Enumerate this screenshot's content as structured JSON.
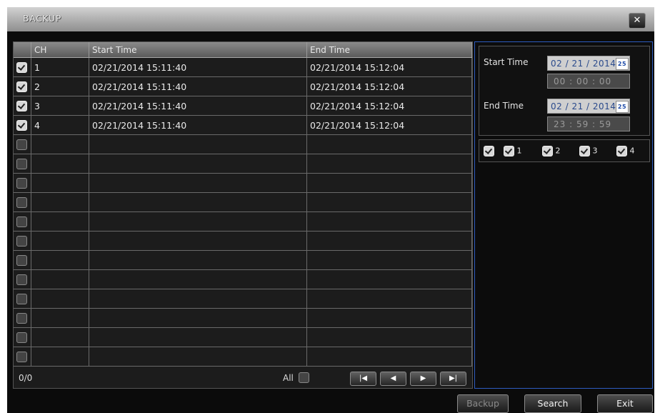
{
  "window": {
    "title": "BACKUP",
    "close_icon": "close-icon"
  },
  "table": {
    "headers": {
      "ch": "CH",
      "start": "Start Time",
      "end": "End Time"
    },
    "rows": [
      {
        "checked": true,
        "ch": "1",
        "start": "02/21/2014 15:11:40",
        "end": "02/21/2014 15:12:04"
      },
      {
        "checked": true,
        "ch": "2",
        "start": "02/21/2014 15:11:40",
        "end": "02/21/2014 15:12:04"
      },
      {
        "checked": true,
        "ch": "3",
        "start": "02/21/2014 15:11:40",
        "end": "02/21/2014 15:12:04"
      },
      {
        "checked": true,
        "ch": "4",
        "start": "02/21/2014 15:11:40",
        "end": "02/21/2014 15:12:04"
      },
      {
        "checked": false,
        "ch": "",
        "start": "",
        "end": ""
      },
      {
        "checked": false,
        "ch": "",
        "start": "",
        "end": ""
      },
      {
        "checked": false,
        "ch": "",
        "start": "",
        "end": ""
      },
      {
        "checked": false,
        "ch": "",
        "start": "",
        "end": ""
      },
      {
        "checked": false,
        "ch": "",
        "start": "",
        "end": ""
      },
      {
        "checked": false,
        "ch": "",
        "start": "",
        "end": ""
      },
      {
        "checked": false,
        "ch": "",
        "start": "",
        "end": ""
      },
      {
        "checked": false,
        "ch": "",
        "start": "",
        "end": ""
      },
      {
        "checked": false,
        "ch": "",
        "start": "",
        "end": ""
      },
      {
        "checked": false,
        "ch": "",
        "start": "",
        "end": ""
      },
      {
        "checked": false,
        "ch": "",
        "start": "",
        "end": ""
      },
      {
        "checked": false,
        "ch": "",
        "start": "",
        "end": ""
      }
    ]
  },
  "footer": {
    "count": "0/0",
    "all_label": "All",
    "all_checked": false,
    "pager": {
      "first": "first-page-icon",
      "prev": "prev-page-icon",
      "next": "next-page-icon",
      "last": "last-page-icon"
    }
  },
  "search_panel": {
    "start_label": "Start Time",
    "start_date": "02 / 21 / 2014",
    "start_time": "00 : 00 : 00",
    "end_label": "End Time",
    "end_date": "02 / 21 / 2014",
    "end_time": "23 : 59 : 59",
    "calendar_icon_text": "25",
    "channels": [
      {
        "label": "",
        "checked": true
      },
      {
        "label": "1",
        "checked": true
      },
      {
        "label": "2",
        "checked": true
      },
      {
        "label": "3",
        "checked": true
      },
      {
        "label": "4",
        "checked": true
      }
    ]
  },
  "buttons": {
    "backup": "Backup",
    "search": "Search",
    "exit": "Exit"
  },
  "colors": {
    "accent_border": "#2e5cc0",
    "title_bar": "#b3b3b3",
    "date_text": "#2a4a8c"
  }
}
